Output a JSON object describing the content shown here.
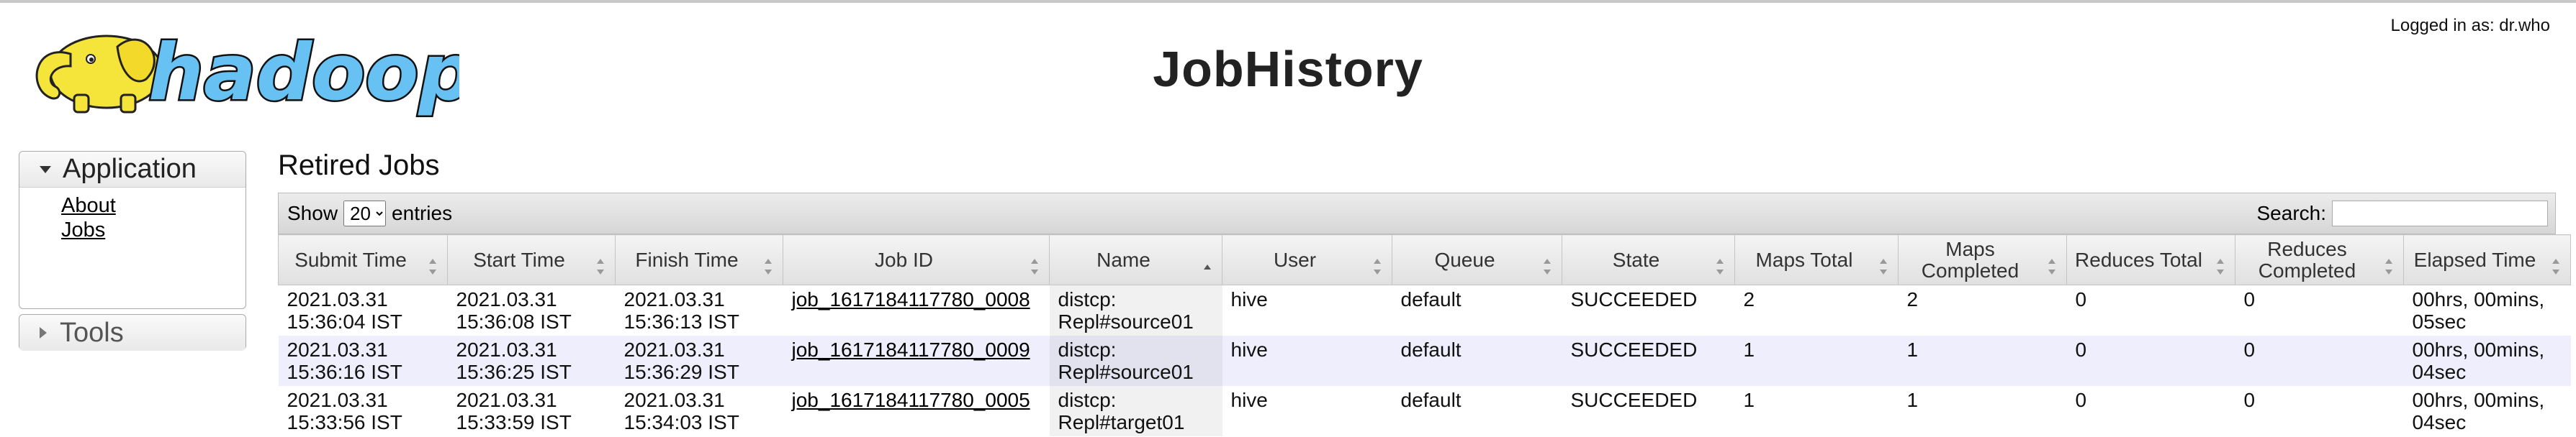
{
  "header": {
    "title": "JobHistory",
    "logged_in": "Logged in as: dr.who",
    "logo_text": "hadoop"
  },
  "sidebar": {
    "application": {
      "label": "Application",
      "links": [
        {
          "label": "About"
        },
        {
          "label": "Jobs"
        }
      ]
    },
    "tools": {
      "label": "Tools"
    }
  },
  "main": {
    "section_title": "Retired Jobs",
    "show_label": "Show",
    "entries_value": "20",
    "entries_label": "entries",
    "search_label": "Search:",
    "search_value": "",
    "columns": [
      {
        "label": "Submit Time"
      },
      {
        "label": "Start Time"
      },
      {
        "label": "Finish Time"
      },
      {
        "label": "Job ID"
      },
      {
        "label": "Name"
      },
      {
        "label": "User"
      },
      {
        "label": "Queue"
      },
      {
        "label": "State"
      },
      {
        "label": "Maps Total"
      },
      {
        "label": "Maps Completed"
      },
      {
        "label": "Reduces Total"
      },
      {
        "label": "Reduces Completed"
      },
      {
        "label": "Elapsed Time"
      }
    ],
    "rows": [
      {
        "submit_date": "2021.03.31",
        "submit_time": "15:36:04 IST",
        "start_date": "2021.03.31",
        "start_time": "15:36:08 IST",
        "finish_date": "2021.03.31",
        "finish_time": "15:36:13 IST",
        "job_id": "job_1617184117780_0008",
        "name_1": "distcp:",
        "name_2": "Repl#source01",
        "user": "hive",
        "queue": "default",
        "state": "SUCCEEDED",
        "maps_total": "2",
        "maps_completed": "2",
        "reduces_total": "0",
        "reduces_completed": "0",
        "elapsed_1": "00hrs, 00mins,",
        "elapsed_2": "05sec"
      },
      {
        "submit_date": "2021.03.31",
        "submit_time": "15:36:16 IST",
        "start_date": "2021.03.31",
        "start_time": "15:36:25 IST",
        "finish_date": "2021.03.31",
        "finish_time": "15:36:29 IST",
        "job_id": "job_1617184117780_0009",
        "name_1": "distcp:",
        "name_2": "Repl#source01",
        "user": "hive",
        "queue": "default",
        "state": "SUCCEEDED",
        "maps_total": "1",
        "maps_completed": "1",
        "reduces_total": "0",
        "reduces_completed": "0",
        "elapsed_1": "00hrs, 00mins,",
        "elapsed_2": "04sec"
      },
      {
        "submit_date": "2021.03.31",
        "submit_time": "15:33:56 IST",
        "start_date": "2021.03.31",
        "start_time": "15:33:59 IST",
        "finish_date": "2021.03.31",
        "finish_time": "15:34:03 IST",
        "job_id": "job_1617184117780_0005",
        "name_1": "distcp:",
        "name_2": "Repl#target01",
        "user": "hive",
        "queue": "default",
        "state": "SUCCEEDED",
        "maps_total": "1",
        "maps_completed": "1",
        "reduces_total": "0",
        "reduces_completed": "0",
        "elapsed_1": "00hrs, 00mins,",
        "elapsed_2": "04sec"
      }
    ]
  },
  "colors": {
    "row_even": "#eeeefc",
    "header_gradient_top": "#f4f4f4",
    "header_gradient_bottom": "#e0e0e0",
    "logo_yellow": "#f5e43a",
    "logo_blue": "#67c1f2"
  }
}
